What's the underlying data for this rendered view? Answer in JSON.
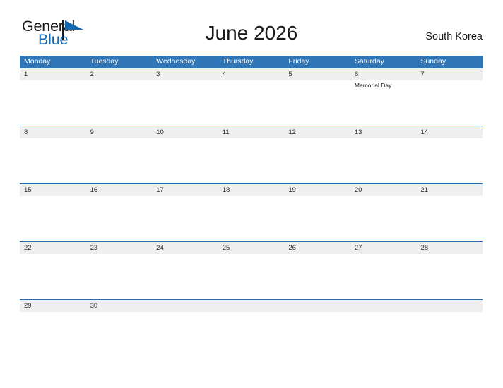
{
  "brand": {
    "name_top": "General",
    "name_bottom": "Blue",
    "flag_icon": "flag-triangle-icon",
    "accent_color": "#1569b0"
  },
  "header": {
    "title": "June 2026",
    "country": "South Korea"
  },
  "calendar": {
    "header_bg": "#3075b5",
    "number_strip_bg": "#efefef",
    "divider_color": "#2a6ca8",
    "weekdays": [
      "Monday",
      "Tuesday",
      "Wednesday",
      "Thursday",
      "Friday",
      "Saturday",
      "Sunday"
    ],
    "weeks": [
      {
        "days": [
          {
            "num": "1",
            "events": []
          },
          {
            "num": "2",
            "events": []
          },
          {
            "num": "3",
            "events": []
          },
          {
            "num": "4",
            "events": []
          },
          {
            "num": "5",
            "events": []
          },
          {
            "num": "6",
            "events": [
              "Memorial Day"
            ]
          },
          {
            "num": "7",
            "events": []
          }
        ]
      },
      {
        "days": [
          {
            "num": "8",
            "events": []
          },
          {
            "num": "9",
            "events": []
          },
          {
            "num": "10",
            "events": []
          },
          {
            "num": "11",
            "events": []
          },
          {
            "num": "12",
            "events": []
          },
          {
            "num": "13",
            "events": []
          },
          {
            "num": "14",
            "events": []
          }
        ]
      },
      {
        "days": [
          {
            "num": "15",
            "events": []
          },
          {
            "num": "16",
            "events": []
          },
          {
            "num": "17",
            "events": []
          },
          {
            "num": "18",
            "events": []
          },
          {
            "num": "19",
            "events": []
          },
          {
            "num": "20",
            "events": []
          },
          {
            "num": "21",
            "events": []
          }
        ]
      },
      {
        "days": [
          {
            "num": "22",
            "events": []
          },
          {
            "num": "23",
            "events": []
          },
          {
            "num": "24",
            "events": []
          },
          {
            "num": "25",
            "events": []
          },
          {
            "num": "26",
            "events": []
          },
          {
            "num": "27",
            "events": []
          },
          {
            "num": "28",
            "events": []
          }
        ]
      },
      {
        "days": [
          {
            "num": "29",
            "events": []
          },
          {
            "num": "30",
            "events": []
          },
          {
            "num": "",
            "events": []
          },
          {
            "num": "",
            "events": []
          },
          {
            "num": "",
            "events": []
          },
          {
            "num": "",
            "events": []
          },
          {
            "num": "",
            "events": []
          }
        ]
      }
    ]
  }
}
